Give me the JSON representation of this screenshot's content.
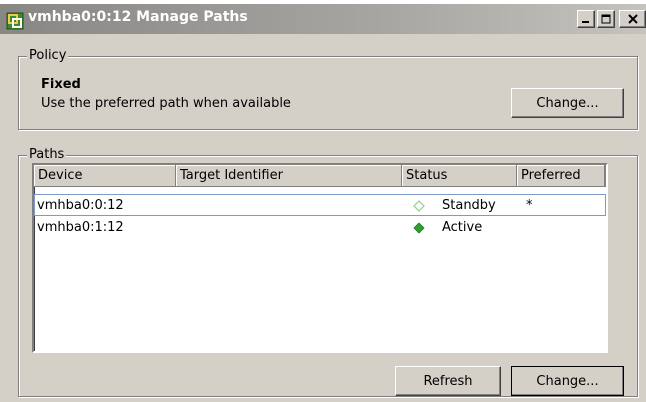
{
  "window": {
    "title": "vmhba0:0:12 Manage Paths",
    "icon": "app-icon",
    "controls": [
      "minimize-icon",
      "maximize-icon",
      "close-icon"
    ]
  },
  "policy": {
    "group_label": "Policy",
    "name": "Fixed",
    "description": "Use the preferred path when available",
    "change_label": "Change..."
  },
  "paths": {
    "group_label": "Paths",
    "columns": [
      "Device",
      "Target Identifier",
      "Status",
      "Preferred"
    ],
    "rows": [
      {
        "device": "vmhba0:0:12",
        "target": "",
        "status": "Standby",
        "status_icon": "hollow-diamond-icon",
        "preferred": "*"
      },
      {
        "device": "vmhba0:1:12",
        "target": "",
        "status": "Active",
        "status_icon": "green-diamond-icon",
        "preferred": ""
      }
    ],
    "refresh_label": "Refresh",
    "change_label": "Change..."
  },
  "colors": {
    "active": "#2ea02e",
    "standby": "#8fd08f",
    "selection_border": "#7b9cc8"
  }
}
